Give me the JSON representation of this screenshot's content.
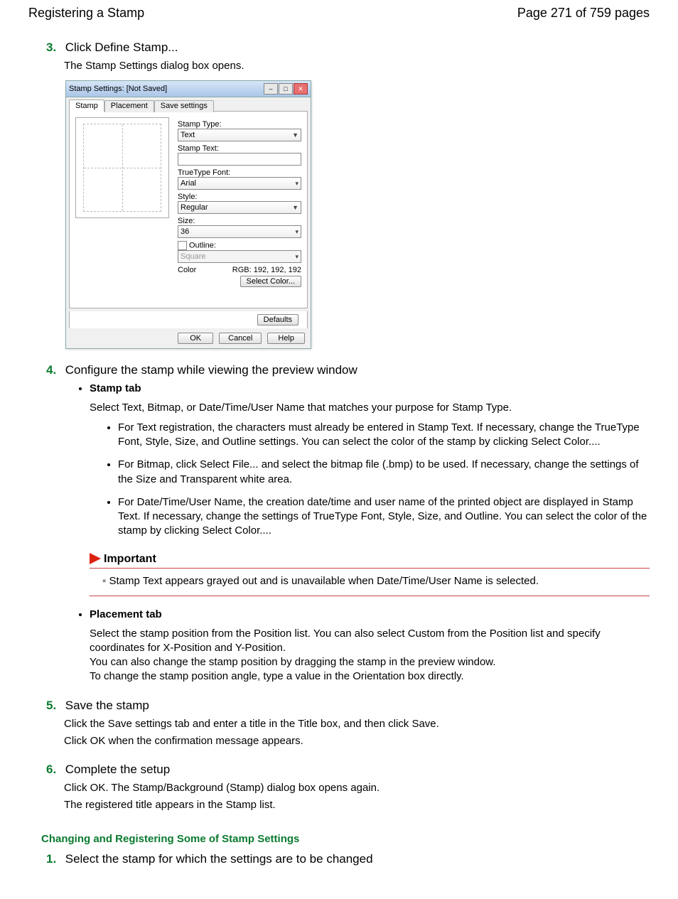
{
  "header": {
    "title": "Registering a Stamp",
    "page_indicator": "Page 271 of 759 pages"
  },
  "steps": {
    "s3": {
      "num": "3.",
      "title": "Click Define Stamp...",
      "body1": "The Stamp Settings dialog box opens."
    },
    "s4": {
      "num": "4.",
      "title": "Configure the stamp while viewing the preview window",
      "stamp_tab_heading": "Stamp tab",
      "stamp_tab_intro": "Select Text, Bitmap, or Date/Time/User Name that matches your purpose for Stamp Type.",
      "b1": "For Text registration, the characters must already be entered in Stamp Text. If necessary, change the TrueType Font, Style, Size, and Outline settings. You can select the color of the stamp by clicking Select Color....",
      "b2": "For Bitmap, click Select File... and select the bitmap file (.bmp) to be used. If necessary, change the settings of the Size and Transparent white area.",
      "b3": "For Date/Time/User Name, the creation date/time and user name of the printed object are displayed in Stamp Text. If necessary, change the settings of TrueType Font, Style, Size, and Outline. You can select the color of the stamp by clicking Select Color....",
      "important_title": "Important",
      "important_body": "Stamp Text appears grayed out and is unavailable when Date/Time/User Name is selected.",
      "placement_heading": "Placement tab",
      "placement_p1": "Select the stamp position from the Position list. You can also select Custom from the Position list and specify coordinates for X-Position and Y-Position.",
      "placement_p2": "You can also change the stamp position by dragging the stamp in the preview window.",
      "placement_p3": "To change the stamp position angle, type a value in the Orientation box directly."
    },
    "s5": {
      "num": "5.",
      "title": "Save the stamp",
      "body1": "Click the Save settings tab and enter a title in the Title box, and then click Save.",
      "body2": "Click OK when the confirmation message appears."
    },
    "s6": {
      "num": "6.",
      "title": "Complete the setup",
      "body1": "Click OK. The Stamp/Background (Stamp) dialog box opens again.",
      "body2": "The registered title appears in the Stamp list."
    }
  },
  "section2": {
    "heading": "Changing and Registering Some of Stamp Settings",
    "s1_num": "1.",
    "s1_title": "Select the stamp for which the settings are to be changed"
  },
  "dialog": {
    "title": "Stamp Settings: [Not Saved]",
    "tabs": {
      "t1": "Stamp",
      "t2": "Placement",
      "t3": "Save settings"
    },
    "labels": {
      "stamp_type": "Stamp Type:",
      "stamp_text": "Stamp Text:",
      "font": "TrueType Font:",
      "style": "Style:",
      "size": "Size:",
      "outline": "Outline:",
      "color": "Color",
      "rgb": "RGB: 192, 192, 192"
    },
    "values": {
      "stamp_type": "Text",
      "font": "Arial",
      "style": "Regular",
      "size": "36",
      "outline": "Square"
    },
    "buttons": {
      "select_color": "Select Color...",
      "defaults": "Defaults",
      "ok": "OK",
      "cancel": "Cancel",
      "help": "Help"
    }
  }
}
